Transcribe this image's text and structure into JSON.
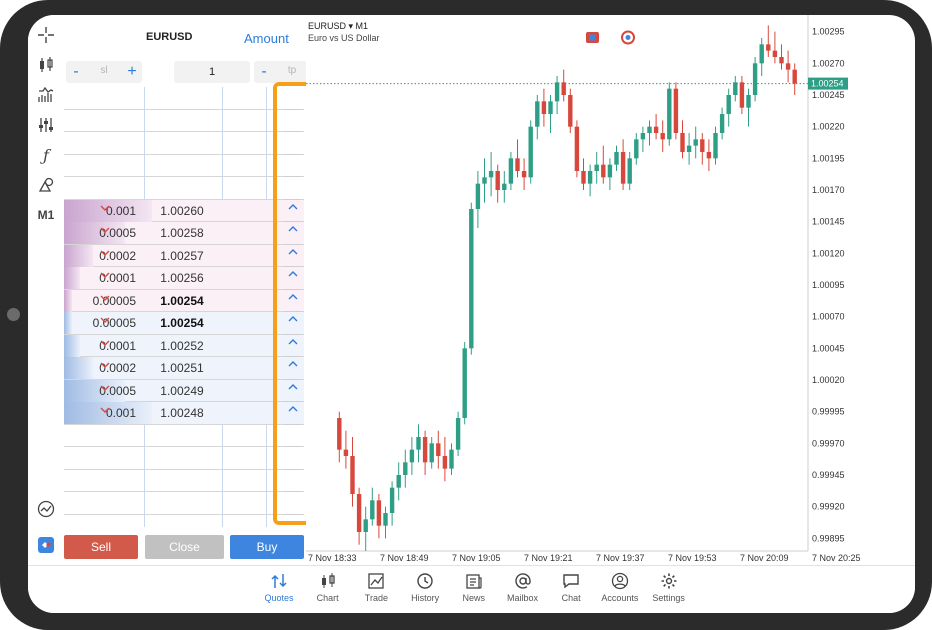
{
  "dom": {
    "symbol": "EURUSD",
    "amount_label": "Amount",
    "sl_placeholder": "sl",
    "tp_placeholder": "tp",
    "quantity": "1",
    "minus": "-",
    "plus": "+",
    "levels": [
      {
        "volume": "0.001",
        "price": "1.00260",
        "side": "ask",
        "bar": 0.55,
        "bold": false
      },
      {
        "volume": "0.0005",
        "price": "1.00258",
        "side": "ask",
        "bar": 0.38,
        "bold": false
      },
      {
        "volume": "0.0002",
        "price": "1.00257",
        "side": "ask",
        "bar": 0.18,
        "bold": false
      },
      {
        "volume": "0.0001",
        "price": "1.00256",
        "side": "ask",
        "bar": 0.1,
        "bold": false
      },
      {
        "volume": "0.00005",
        "price": "1.00254",
        "side": "ask",
        "bar": 0.05,
        "bold": true
      },
      {
        "volume": "0.00005",
        "price": "1.00254",
        "side": "bid",
        "bar": 0.05,
        "bold": true
      },
      {
        "volume": "0.0001",
        "price": "1.00252",
        "side": "bid",
        "bar": 0.1,
        "bold": false
      },
      {
        "volume": "0.0002",
        "price": "1.00251",
        "side": "bid",
        "bar": 0.18,
        "bold": false
      },
      {
        "volume": "0.0005",
        "price": "1.00249",
        "side": "bid",
        "bar": 0.38,
        "bold": false
      },
      {
        "volume": "0.001",
        "price": "1.00248",
        "side": "bid",
        "bar": 0.55,
        "bold": false
      }
    ],
    "sell_label": "Sell",
    "close_label": "Close",
    "buy_label": "Buy"
  },
  "toolbar": {
    "timeframe": "M1"
  },
  "chart": {
    "symbol_line": "EURUSD ▾ M1",
    "description": "Euro vs US Dollar",
    "current_price_label": "1.00254"
  },
  "chart_data": {
    "type": "candlestick",
    "y_ticks": [
      "1.00295",
      "1.00270",
      "1.00245",
      "1.00220",
      "1.00195",
      "1.00170",
      "1.00145",
      "1.00120",
      "1.00095",
      "1.00070",
      "1.00045",
      "1.00020",
      "0.99995",
      "0.99970",
      "0.99945",
      "0.99920",
      "0.99895"
    ],
    "ylim": [
      0.99885,
      1.00305
    ],
    "x_ticks": [
      "7 Nov 18:33",
      "7 Nov 18:49",
      "7 Nov 19:05",
      "7 Nov 19:21",
      "7 Nov 19:37",
      "7 Nov 19:53",
      "7 Nov 20:09",
      "7 Nov 20:25"
    ],
    "current_price": 1.00254,
    "up_color": "#2e9e86",
    "down_color": "#d8473b",
    "candles": [
      [
        0.9999,
        0.99995,
        0.99955,
        0.99965
      ],
      [
        0.99965,
        0.9998,
        0.9995,
        0.9996
      ],
      [
        0.9996,
        0.99975,
        0.9992,
        0.9993
      ],
      [
        0.9993,
        0.99935,
        0.9989,
        0.999
      ],
      [
        0.999,
        0.9992,
        0.99885,
        0.9991
      ],
      [
        0.9991,
        0.99935,
        0.99905,
        0.99925
      ],
      [
        0.99925,
        0.9993,
        0.99895,
        0.99905
      ],
      [
        0.99905,
        0.9992,
        0.99895,
        0.99915
      ],
      [
        0.99915,
        0.9994,
        0.99905,
        0.99935
      ],
      [
        0.99935,
        0.99955,
        0.99925,
        0.99945
      ],
      [
        0.99945,
        0.99965,
        0.99935,
        0.99955
      ],
      [
        0.99955,
        0.99975,
        0.99945,
        0.99965
      ],
      [
        0.99965,
        0.99985,
        0.99955,
        0.99975
      ],
      [
        0.99975,
        0.9998,
        0.99945,
        0.99955
      ],
      [
        0.99955,
        0.99975,
        0.9995,
        0.9997
      ],
      [
        0.9997,
        0.9998,
        0.9995,
        0.9996
      ],
      [
        0.9996,
        0.99975,
        0.9994,
        0.9995
      ],
      [
        0.9995,
        0.9997,
        0.99945,
        0.99965
      ],
      [
        0.99965,
        0.99995,
        0.9996,
        0.9999
      ],
      [
        0.9999,
        1.0005,
        0.99985,
        1.00045
      ],
      [
        1.00045,
        1.0016,
        1.0004,
        1.00155
      ],
      [
        1.00155,
        1.00185,
        1.0014,
        1.00175
      ],
      [
        1.00175,
        1.00195,
        1.0016,
        1.0018
      ],
      [
        1.0018,
        1.002,
        1.00165,
        1.00185
      ],
      [
        1.00185,
        1.0019,
        1.0016,
        1.0017
      ],
      [
        1.0017,
        1.00185,
        1.0016,
        1.00175
      ],
      [
        1.00175,
        1.002,
        1.0017,
        1.00195
      ],
      [
        1.00195,
        1.0021,
        1.0018,
        1.00185
      ],
      [
        1.00185,
        1.00195,
        1.0017,
        1.0018
      ],
      [
        1.0018,
        1.00225,
        1.00175,
        1.0022
      ],
      [
        1.0022,
        1.00245,
        1.0021,
        1.0024
      ],
      [
        1.0024,
        1.0025,
        1.0022,
        1.0023
      ],
      [
        1.0023,
        1.00245,
        1.00215,
        1.0024
      ],
      [
        1.0024,
        1.0026,
        1.0023,
        1.00255
      ],
      [
        1.00255,
        1.00265,
        1.0024,
        1.00245
      ],
      [
        1.00245,
        1.0025,
        1.00215,
        1.0022
      ],
      [
        1.0022,
        1.00225,
        1.0018,
        1.00185
      ],
      [
        1.00185,
        1.00195,
        1.0017,
        1.00175
      ],
      [
        1.00175,
        1.0019,
        1.00165,
        1.00185
      ],
      [
        1.00185,
        1.002,
        1.00175,
        1.0019
      ],
      [
        1.0019,
        1.00205,
        1.00175,
        1.0018
      ],
      [
        1.0018,
        1.00195,
        1.0017,
        1.0019
      ],
      [
        1.0019,
        1.00205,
        1.00185,
        1.002
      ],
      [
        1.002,
        1.0021,
        1.0017,
        1.00175
      ],
      [
        1.00175,
        1.002,
        1.0017,
        1.00195
      ],
      [
        1.00195,
        1.00215,
        1.0019,
        1.0021
      ],
      [
        1.0021,
        1.0022,
        1.002,
        1.00215
      ],
      [
        1.00215,
        1.00225,
        1.00205,
        1.0022
      ],
      [
        1.0022,
        1.0023,
        1.0021,
        1.00215
      ],
      [
        1.00215,
        1.00225,
        1.002,
        1.0021
      ],
      [
        1.0021,
        1.00255,
        1.00205,
        1.0025
      ],
      [
        1.0025,
        1.00255,
        1.0021,
        1.00215
      ],
      [
        1.00215,
        1.00225,
        1.00195,
        1.002
      ],
      [
        1.002,
        1.00215,
        1.0019,
        1.00205
      ],
      [
        1.00205,
        1.0022,
        1.00195,
        1.0021
      ],
      [
        1.0021,
        1.00215,
        1.0019,
        1.002
      ],
      [
        1.002,
        1.0021,
        1.00185,
        1.00195
      ],
      [
        1.00195,
        1.0022,
        1.0019,
        1.00215
      ],
      [
        1.00215,
        1.00235,
        1.0021,
        1.0023
      ],
      [
        1.0023,
        1.0025,
        1.0022,
        1.00245
      ],
      [
        1.00245,
        1.0026,
        1.0024,
        1.00255
      ],
      [
        1.00255,
        1.0026,
        1.0023,
        1.00235
      ],
      [
        1.00235,
        1.0025,
        1.0022,
        1.00245
      ],
      [
        1.00245,
        1.00275,
        1.0024,
        1.0027
      ],
      [
        1.0027,
        1.0029,
        1.0026,
        1.00285
      ],
      [
        1.00285,
        1.003,
        1.00275,
        1.0028
      ],
      [
        1.0028,
        1.00295,
        1.0027,
        1.00275
      ],
      [
        1.00275,
        1.00285,
        1.00265,
        1.0027
      ],
      [
        1.0027,
        1.0028,
        1.00255,
        1.00265
      ],
      [
        1.00265,
        1.0027,
        1.00245,
        1.00254
      ]
    ]
  },
  "nav": {
    "items": [
      {
        "label": "Quotes",
        "icon": "quotes-icon",
        "active": true
      },
      {
        "label": "Chart",
        "icon": "candles-icon",
        "active": false
      },
      {
        "label": "Trade",
        "icon": "trade-icon",
        "active": false
      },
      {
        "label": "History",
        "icon": "history-icon",
        "active": false
      },
      {
        "label": "News",
        "icon": "news-icon",
        "active": false
      },
      {
        "label": "Mailbox",
        "icon": "mailbox-icon",
        "active": false
      },
      {
        "label": "Chat",
        "icon": "chat-icon",
        "active": false
      },
      {
        "label": "Accounts",
        "icon": "accounts-icon",
        "active": false
      },
      {
        "label": "Settings",
        "icon": "settings-icon",
        "active": false
      }
    ]
  }
}
